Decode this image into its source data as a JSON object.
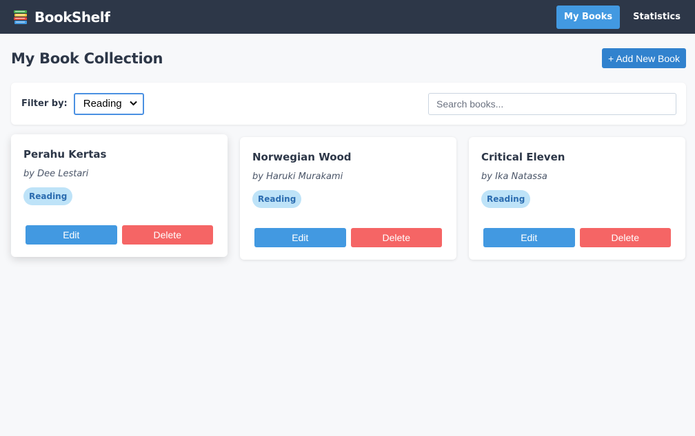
{
  "navbar": {
    "brand": "BookShelf",
    "brand_icon": "books-stack-icon",
    "links": [
      {
        "label": "My Books",
        "active": true
      },
      {
        "label": "Statistics",
        "active": false
      }
    ]
  },
  "page": {
    "title": "My Book Collection",
    "add_button_label": "+ Add New Book"
  },
  "filter": {
    "label": "Filter by:",
    "selected": "Reading",
    "search_placeholder": "Search books..."
  },
  "books": [
    {
      "title": "Perahu Kertas",
      "author": "by Dee Lestari",
      "status": "Reading",
      "edit_label": "Edit",
      "delete_label": "Delete"
    },
    {
      "title": "Norwegian Wood",
      "author": "by Haruki Murakami",
      "status": "Reading",
      "edit_label": "Edit",
      "delete_label": "Delete"
    },
    {
      "title": "Critical Eleven",
      "author": "by Ika Natassa",
      "status": "Reading",
      "edit_label": "Edit",
      "delete_label": "Delete"
    }
  ],
  "colors": {
    "navbar_bg": "#2d3748",
    "accent": "#4299e1",
    "primary": "#3182ce",
    "danger": "#f56565",
    "badge_bg": "#bee3f8",
    "badge_text": "#2b6cb0"
  }
}
